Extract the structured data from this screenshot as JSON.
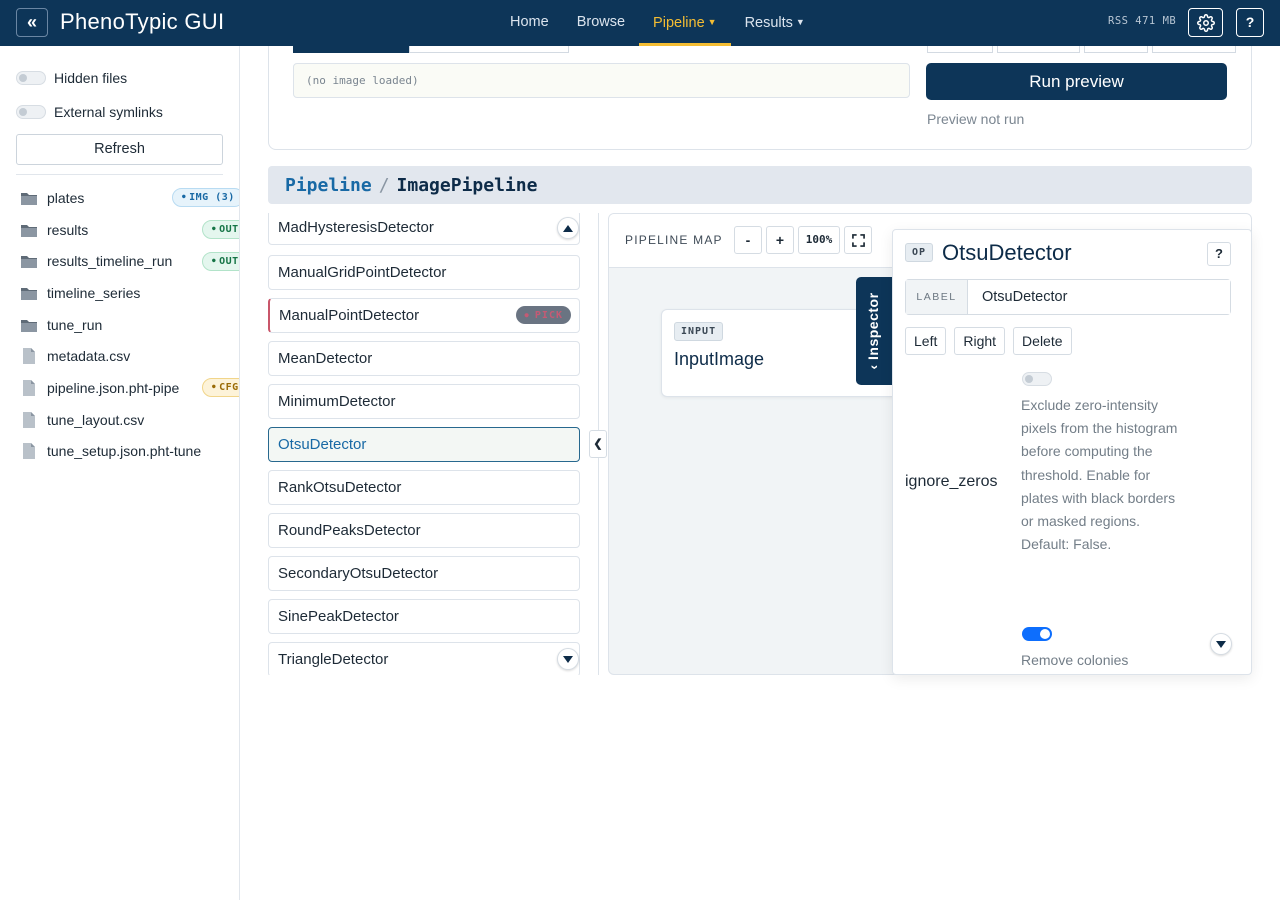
{
  "app": {
    "title": "PhenoTypic GUI"
  },
  "nav": {
    "items": [
      {
        "label": "Home",
        "active": false,
        "dropdown": false
      },
      {
        "label": "Browse",
        "active": false,
        "dropdown": false
      },
      {
        "label": "Pipeline",
        "active": true,
        "dropdown": true
      },
      {
        "label": "Results",
        "active": false,
        "dropdown": true
      }
    ]
  },
  "status": {
    "rss": "RSS 471 MB"
  },
  "help_label": "?",
  "sidebar": {
    "hidden_files": "Hidden files",
    "external_symlinks": "External symlinks",
    "refresh": "Refresh",
    "files": [
      {
        "name": "plates",
        "type": "folder",
        "tag": "IMG (3)",
        "tag_kind": "img"
      },
      {
        "name": "results",
        "type": "folder",
        "tag": "OUT",
        "tag_kind": "out"
      },
      {
        "name": "results_timeline_run",
        "type": "folder",
        "tag": "OUT",
        "tag_kind": "out"
      },
      {
        "name": "timeline_series",
        "type": "folder"
      },
      {
        "name": "tune_run",
        "type": "folder"
      },
      {
        "name": "metadata.csv",
        "type": "file"
      },
      {
        "name": "pipeline.json.pht-pipe",
        "type": "file",
        "tag": "CFG",
        "tag_kind": "cfg"
      },
      {
        "name": "tune_layout.csv",
        "type": "file"
      },
      {
        "name": "tune_setup.json.pht-tune",
        "type": "file"
      }
    ]
  },
  "preview": {
    "image_placeholder": "(no image loaded)",
    "run_label": "Run preview",
    "status": "Preview not run"
  },
  "breadcrumb": {
    "root": "Pipeline",
    "sep": "/",
    "leaf": "ImagePipeline"
  },
  "detectors": {
    "items": [
      {
        "label": "MadHysteresisDetector"
      },
      {
        "label": "ManualGridPointDetector"
      },
      {
        "label": "ManualPointDetector",
        "badge": "PICK"
      },
      {
        "label": "MeanDetector"
      },
      {
        "label": "MinimumDetector"
      },
      {
        "label": "OtsuDetector",
        "selected": true
      },
      {
        "label": "RankOtsuDetector"
      },
      {
        "label": "RoundPeaksDetector"
      },
      {
        "label": "SecondaryOtsuDetector"
      },
      {
        "label": "SinePeakDetector"
      },
      {
        "label": "TriangleDetector"
      }
    ],
    "collapse_glyph": "❮"
  },
  "map": {
    "label": "PIPELINE MAP",
    "zoom_out": "-",
    "zoom_in": "+",
    "zoom": "100%",
    "input_node": {
      "tag": "INPUT",
      "title": "InputImage"
    },
    "inspector_tab": "Inspector"
  },
  "inspector": {
    "op_tag": "OP",
    "title": "OtsuDetector",
    "help": "?",
    "label_prefix": "LABEL",
    "label_value": "OtsuDetector",
    "actions": {
      "left": "Left",
      "right": "Right",
      "delete": "Delete"
    },
    "param": {
      "name": "ignore_zeros",
      "enabled": false,
      "description": "Exclude zero-intensity pixels from the histogram before computing the threshold. Enable for plates with black borders or masked regions. Default: False."
    },
    "next_param": {
      "enabled": true,
      "label": "Remove colonies"
    }
  },
  "colors": {
    "navy": "#0d3558",
    "accent": "#f4bd33",
    "link_blue": "#1869a5",
    "toggle_on": "#0d6efd"
  }
}
